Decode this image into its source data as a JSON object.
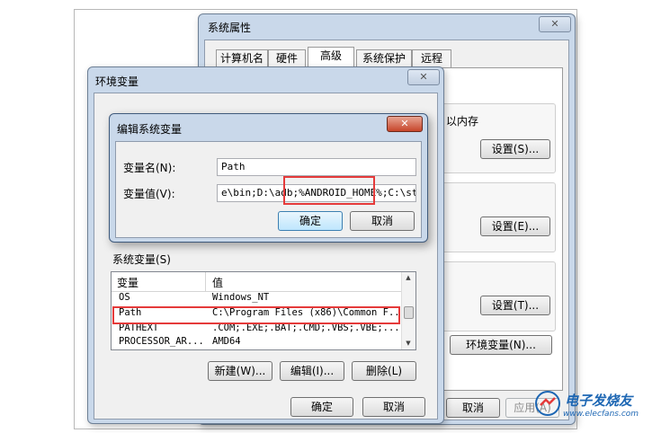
{
  "system_properties": {
    "title": "系统属性",
    "tabs": [
      "计算机名",
      "硬件",
      "高级",
      "系统保护",
      "远程"
    ],
    "active_tab_index": 2,
    "partial_text": "以内存",
    "settings_buttons": [
      "设置(S)...",
      "设置(E)...",
      "设置(T)..."
    ],
    "env_vars_button": "环境变量(N)...",
    "cancel_button": "取消",
    "apply_button": "应用(A)"
  },
  "env_vars": {
    "title": "环境变量",
    "system_vars_label": "系统变量(S)",
    "columns": [
      "变量",
      "值"
    ],
    "rows": [
      {
        "name": "OS",
        "value": "Windows_NT"
      },
      {
        "name": "Path",
        "value": "C:\\Program Files (x86)\\Common F..."
      },
      {
        "name": "PATHEXT",
        "value": ".COM;.EXE;.BAT;.CMD;.VBS;.VBE;..."
      },
      {
        "name": "PROCESSOR_AR...",
        "value": "AMD64"
      }
    ],
    "new_button": "新建(W)...",
    "edit_button": "编辑(I)...",
    "delete_button": "删除(L)",
    "ok_button": "确定",
    "cancel_button": "取消"
  },
  "edit_dialog": {
    "title": "编辑系统变量",
    "name_label": "变量名(N):",
    "name_value": "Path",
    "value_label": "变量值(V):",
    "value_text_before": "e\\bin;D:\\adb;",
    "value_text_highlight": "%ANDROID_HOME%",
    "value_text_after": ";C:\\stran",
    "ok_button": "确定",
    "cancel_button": "取消"
  },
  "watermark": {
    "brand": "电子发烧友",
    "url": "www.elecfans.com"
  },
  "colors": {
    "highlight_red": "#e53a3a",
    "title_bar": "#c9d8ea",
    "close_red": "#c7452a"
  }
}
